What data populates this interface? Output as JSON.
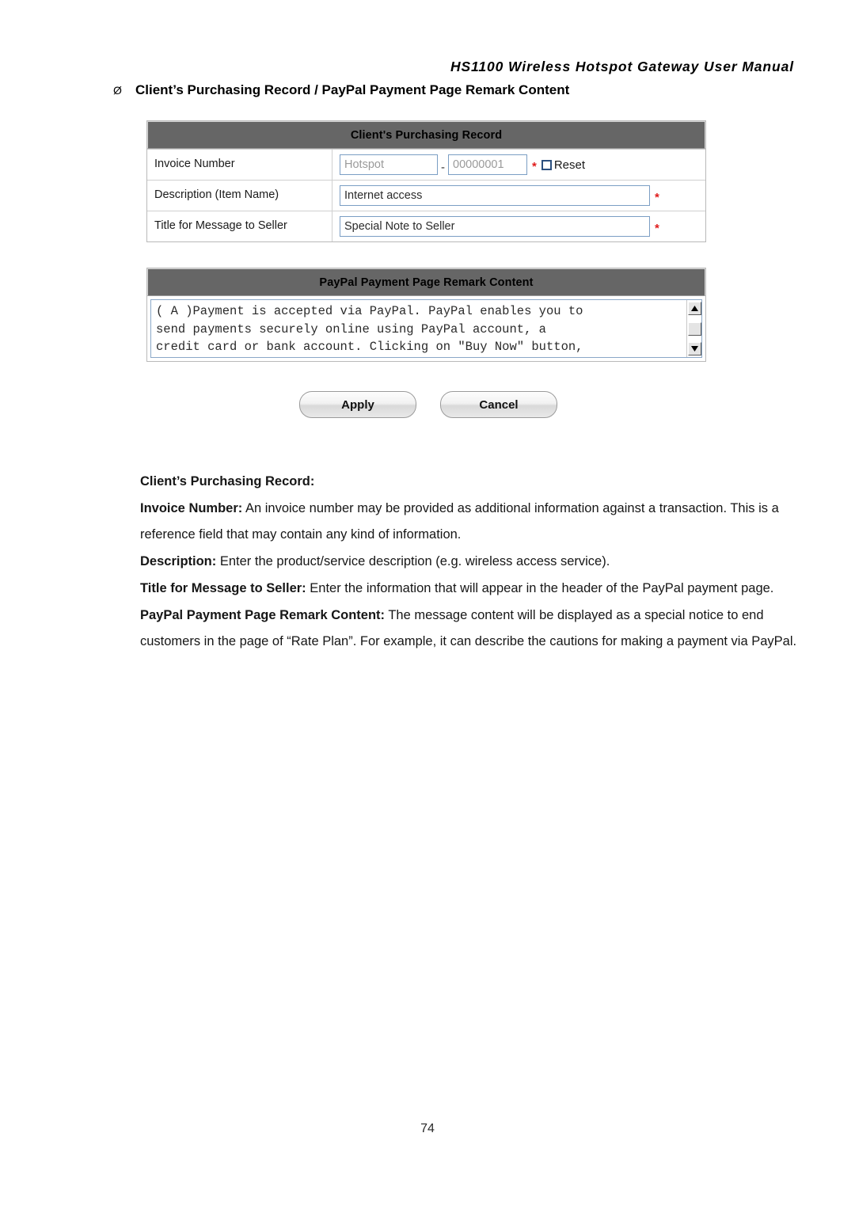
{
  "document": {
    "running_header": "HS1100 Wireless Hotspot Gateway User Manual",
    "bullet_marker": "Ø",
    "section_heading": "Client’s Purchasing Record / PayPal Payment Page Remark Content",
    "page_number": "74"
  },
  "purchasing_panel": {
    "title": "Client's Purchasing Record",
    "rows": [
      {
        "label": "Invoice Number",
        "prefix_value": "Hotspot",
        "separator": "-",
        "serial_value": "00000001",
        "required_mark": "*",
        "reset_label": "Reset",
        "reset_checked": false
      },
      {
        "label": "Description (Item Name)",
        "value": "Internet access",
        "required_mark": "*"
      },
      {
        "label": "Title for Message to Seller",
        "value": "Special Note to Seller",
        "required_mark": "*"
      }
    ]
  },
  "remark_panel": {
    "title": "PayPal Payment Page Remark Content",
    "textarea_value": "( A )Payment is accepted via PayPal. PayPal enables you to\nsend payments securely online using PayPal account, a\ncredit card or bank account. Clicking on \"Buy Now\" button,",
    "scroll_up_icon": "triangle-up-icon",
    "scroll_down_icon": "triangle-down-icon"
  },
  "buttons": {
    "apply": "Apply",
    "cancel": "Cancel"
  },
  "description": {
    "heading": "Client’s Purchasing Record:",
    "invoice_label": "Invoice Number:",
    "invoice_text": " An invoice number may be provided as additional information against a transaction. This is a reference field that may contain any kind of information.",
    "description_label": "Description:",
    "description_text": " Enter the product/service description (e.g. wireless access service).",
    "title_seller_label": "Title for Message to Seller:",
    "title_seller_text": " Enter the information that will appear in the header of the PayPal payment page.",
    "remark_label": "PayPal Payment Page Remark Content:",
    "remark_text": " The message content will be displayed as a special notice to end customers in the page of “Rate Plan”. For example, it can describe the cautions for making a payment via PayPal."
  }
}
